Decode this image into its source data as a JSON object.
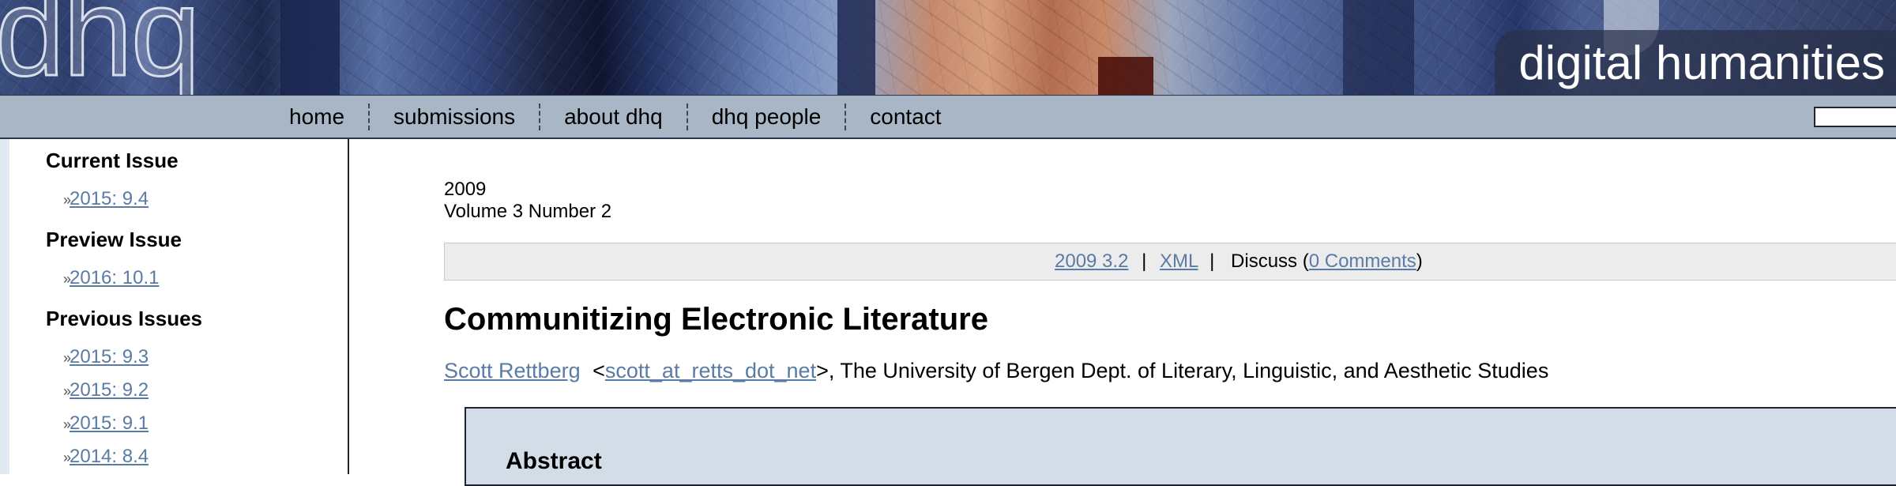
{
  "header": {
    "logo_text": "dhq",
    "site_title": "digital humanities"
  },
  "nav": {
    "items": [
      {
        "label": "home"
      },
      {
        "label": "submissions"
      },
      {
        "label": "about dhq"
      },
      {
        "label": "dhq people"
      },
      {
        "label": "contact"
      }
    ],
    "search_value": ""
  },
  "sidebar": {
    "current_issue": {
      "heading": "Current Issue",
      "links": [
        "2015: 9.4"
      ]
    },
    "preview_issue": {
      "heading": "Preview Issue",
      "links": [
        "2016: 10.1"
      ]
    },
    "previous_issues": {
      "heading": "Previous Issues",
      "links": [
        "2015: 9.3",
        "2015: 9.2",
        "2015: 9.1",
        "2014: 8.4"
      ]
    },
    "arrow_glyph": "»"
  },
  "article": {
    "year": "2009",
    "volume": "Volume 3 Number 2",
    "toolbar": {
      "issue_link": "2009 3.2",
      "sep1": "|",
      "xml_link": "XML",
      "sep2": "|",
      "discuss_prefix": "Discuss (",
      "comments_link": "0 Comments",
      "discuss_suffix": ")"
    },
    "title": "Communitizing Electronic Literature",
    "author": {
      "name": "Scott Rettberg",
      "email_open": "<",
      "email": "scott_at_retts_dot_net",
      "affiliation": ">, The University of Bergen Dept. of Literary, Linguistic, and Aesthetic Studies"
    },
    "abstract_heading": "Abstract"
  }
}
